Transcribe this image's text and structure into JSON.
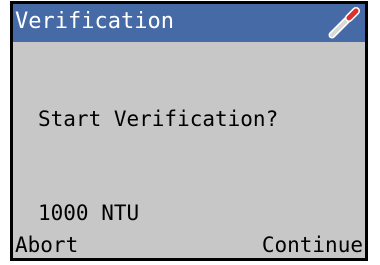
{
  "header": {
    "title": "Verification",
    "icon": "probe-icon",
    "background_color": "#466aa6"
  },
  "screen": {
    "prompt": "Start Verification?",
    "standard_value": "1000 NTU",
    "background_color": "#c7c7c7"
  },
  "softkeys": {
    "left_label": "Abort",
    "right_label": "Continue"
  }
}
